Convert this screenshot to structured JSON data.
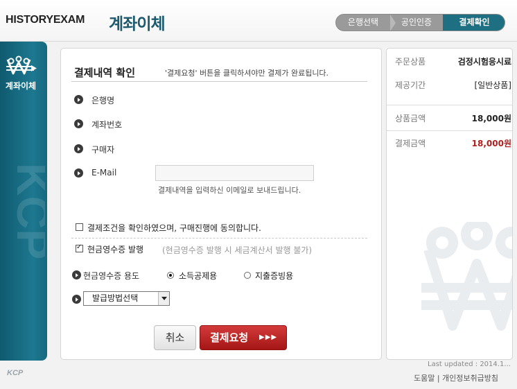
{
  "header": {
    "brand": "HISTORYEXAM",
    "title": "계좌이체",
    "steps": [
      "은행선택",
      "공인인증",
      "결제확인"
    ],
    "active_step": 3
  },
  "rail": {
    "label": "계좌이체",
    "watermark": "KCP",
    "footer_logo": "KCP"
  },
  "main": {
    "title": "결제내역 확인",
    "description": "'결제요청' 버튼을 클릭하셔야만 결제가 완료됩니다.",
    "fields": {
      "bank_label": "은행명",
      "account_label": "계좌번호",
      "buyer_label": "구매자",
      "email_label": "E-Mail"
    },
    "email_value": "",
    "email_note": "결제내역을 입력하신 이메일로 보내드립니다.",
    "agree_label": "결제조건을 확인하였으며, 구매진행에 동의합니다.",
    "agree_checked": false,
    "receipt_label": "현금영수증 발행",
    "receipt_checked": true,
    "receipt_note": "(현금영수증 발행 시 세금계산서 발행 불가)",
    "usage_label": "현금영수증 용도",
    "usage_options": [
      "소득공제용",
      "지출증빙용"
    ],
    "usage_selected": "소득공제용",
    "method_select": "발급방법선택",
    "cancel_label": "취소",
    "submit_label": "결제요청",
    "submit_arrows": "▶▶▶"
  },
  "summary": {
    "product_key": "주문상품",
    "product_value": "검정시험응시료",
    "period_key": "제공기간",
    "period_value": "[일반상품]",
    "price_key": "상품금액",
    "price_value": "18,000원",
    "pay_key": "결제금액",
    "pay_value": "18,000원"
  },
  "footer": {
    "last_updated": "Last updated : 2014.1...",
    "links": "도움말 | 개인정보취급방침"
  },
  "colors": {
    "accent": "#1d5a6e",
    "active_step": "#1f6f82",
    "submit": "#b52020",
    "amount": "#b01e1e"
  }
}
